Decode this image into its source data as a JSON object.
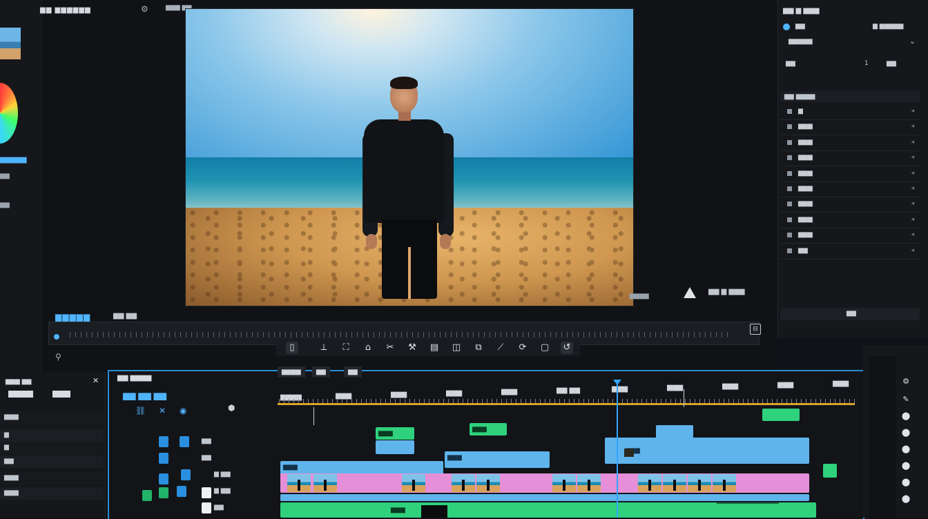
{
  "app": {
    "viewer_title": "▆▆ ▆▆▆▆▆▆",
    "viewer_subtitle": "▆▆▆ ▆▆",
    "viewer_footer_label": "▆▆▆▆▆",
    "viewer_footer_value": "▆▆ ▆▆",
    "viewer_right_label": "▆▆ ▆ ▆▆▆",
    "viewer_right_small": "▆▆▆▆"
  },
  "left_panel": {
    "label_1": "▆▆▆▆▆",
    "label_2": "▆▆",
    "label_3": "▆▆"
  },
  "inspector": {
    "header": "▆▆ ▆ ▆▆▆",
    "row1_label": "▆▆",
    "row1_value": "▆ ▆▆▆▆▆",
    "row2_label": "▆▆▆▆▆",
    "row3_label": "▆▆",
    "row3_value": "1",
    "row3_right": "▆▆",
    "list_header": "▆▆ ▆▆▆▆",
    "items": [
      "▆",
      "▆▆▆",
      "▆▆▆",
      "▆▆▆",
      "▆▆▆",
      "▆▆▆",
      "▆▆▆",
      "▆▆▆",
      "▆▆▆",
      "▆▆"
    ],
    "slider_value": "▆▆"
  },
  "transport": {
    "buttons": [
      "▯",
      "⟂",
      "⛶",
      "⌂",
      "✂",
      "⚒",
      "▤",
      "◫",
      "⧉",
      "⟋",
      "⟳",
      "▢",
      "↺"
    ]
  },
  "timeline": {
    "header": "▆▆ ▆▆▆▆",
    "tools": "▆▆ ▆▆ ▆▆",
    "sequence_tabs": [
      "▆▆▆▆",
      "▆▆",
      "▆▆"
    ],
    "ruler_labels": [
      "▆▆▆▆",
      "▆▆▆",
      "▆▆▆",
      "▆▆▆",
      "▆▆▆",
      "▆▆ ▆▆",
      "▆▆▆",
      "▆▆▆",
      "▆▆▆",
      "▆▆▆",
      "▆▆▆"
    ],
    "track_labels": [
      "▆▆",
      "▆▆",
      "▆ ▆▆",
      "▆ ▆▆",
      "▆▆"
    ],
    "clip_labels": {
      "c1": "▆▆▆",
      "c2": "▆▆▆",
      "c3": "▆▆▆",
      "c4": "▆▆▆",
      "c5": "▆▆▆",
      "c6": "▆▆▆"
    }
  },
  "left_timeline_panel": {
    "header": "▆▆▆ ▆▆",
    "rows": [
      "▆▆▆",
      "▆",
      "▆",
      "▆▆",
      "▆▆▆",
      "▆▆▆"
    ]
  },
  "colors": {
    "accent": "#4fb4ff",
    "clip_blue": "#5fb4ec",
    "clip_green": "#2fd17d",
    "clip_pink": "#e58fd8",
    "ruler_gold": "#d7a52b"
  }
}
